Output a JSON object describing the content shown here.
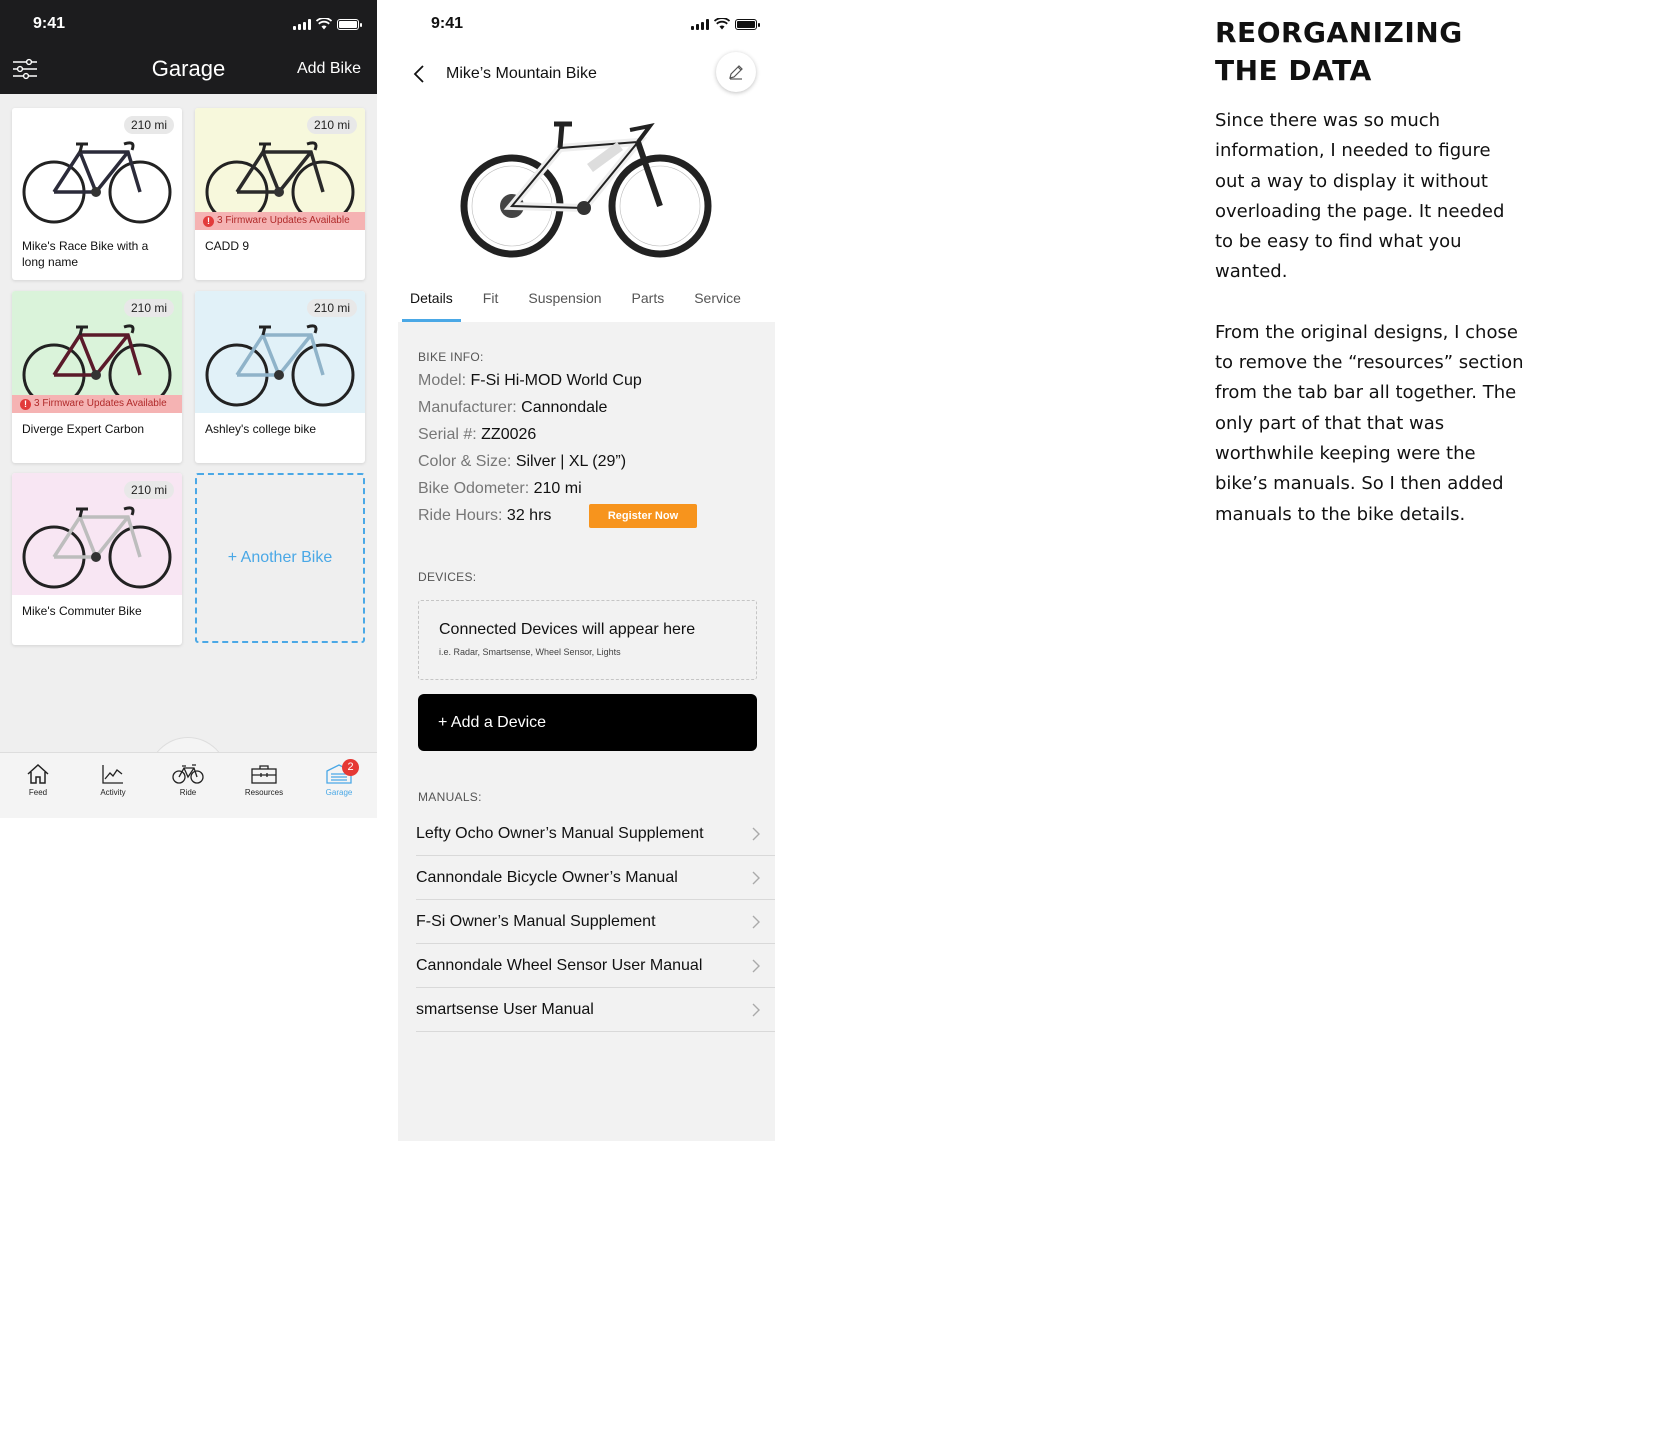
{
  "garage_screen": {
    "status": {
      "time": "9:41"
    },
    "header": {
      "title": "Garage",
      "add_bike_label": "Add Bike",
      "filter_icon": "sliders-icon"
    },
    "bikes": [
      {
        "name": "Mike's Race Bike with a long name",
        "odometer": "210 mi",
        "bg": "#ffffff",
        "frame": "#2b2b3a",
        "alert": ""
      },
      {
        "name": "CADD 9",
        "odometer": "210 mi",
        "bg": "#f7f8dc",
        "frame": "#2a2a2a",
        "alert": "3 Firmware Updates Available"
      },
      {
        "name": "Diverge Expert Carbon",
        "odometer": "210 mi",
        "bg": "#daf3da",
        "frame": "#5a1a2a",
        "alert": "3 Firmware Updates Available"
      },
      {
        "name": "Ashley's college bike",
        "odometer": "210 mi",
        "bg": "#e1f1f8",
        "frame": "#8fb3c9",
        "alert": ""
      },
      {
        "name": "Mike's Commuter Bike",
        "odometer": "210 mi",
        "bg": "#f8e6f3",
        "frame": "#bdbdbd",
        "alert": ""
      }
    ],
    "alert_count_glyph": "!",
    "another_bike_label": "+  Another Bike",
    "tabbar": [
      {
        "label": "Feed",
        "icon": "home-icon"
      },
      {
        "label": "Activity",
        "icon": "activity-chart-icon"
      },
      {
        "label": "Ride",
        "icon": "bike-icon"
      },
      {
        "label": "Resources",
        "icon": "toolbox-icon"
      },
      {
        "label": "Garage",
        "icon": "garage-icon",
        "badge": "2"
      }
    ],
    "accent_color": "#4aa8e6"
  },
  "details_screen": {
    "status": {
      "time": "9:41"
    },
    "title": "Mike’s Mountain Bike",
    "tabs": [
      "Details",
      "Fit",
      "Suspension",
      "Parts",
      "Service"
    ],
    "active_tab": "Details",
    "bike_info": {
      "label": "BIKE INFO:",
      "rows": [
        {
          "key": "Model: ",
          "value": "F-Si Hi-MOD World Cup"
        },
        {
          "key": "Manufacturer: ",
          "value": "Cannondale"
        },
        {
          "key": "Serial #: ",
          "value": "ZZ0026"
        },
        {
          "key": "Color & Size: ",
          "value": "Silver | XL (29”)"
        },
        {
          "key": "Bike Odometer: ",
          "value": "210 mi"
        },
        {
          "key": "Ride Hours: ",
          "value": "32 hrs"
        }
      ],
      "register_label": "Register Now",
      "register_color": "#f7941d"
    },
    "devices": {
      "label": "DEVICES:",
      "empty_title": "Connected Devices will appear here",
      "empty_sub": "i.e. Radar, Smartsense, Wheel Sensor, Lights",
      "add_label": "+ Add a Device"
    },
    "manuals": {
      "label": "MANUALS:",
      "items": [
        "Lefty Ocho Owner’s Manual Supplement",
        "Cannondale Bicycle Owner’s Manual",
        "F-Si Owner’s Manual Supplement",
        "Cannondale Wheel Sensor User Manual",
        "smartsense User Manual"
      ]
    }
  },
  "article": {
    "heading": "REORGANIZING THE DATA",
    "paragraphs": [
      "Since there was so much information, I needed to figure out a way to display it without overloading the page. It needed to be easy to find what you wanted.",
      "From the original designs, I chose to remove the “resources” section from the tab bar all together. The only part of that that was worthwhile keeping were the bike’s manuals. So I then added manuals to the bike details."
    ]
  }
}
